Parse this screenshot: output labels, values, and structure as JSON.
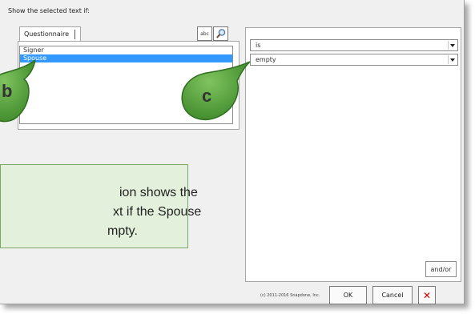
{
  "dialog": {
    "caption": "Show the selected text if:",
    "tab_label": "Questionnaire",
    "toolbar": {
      "abc_label": "abc",
      "search_icon": "search-icon"
    },
    "list_items": [
      "Signer",
      "Spouse"
    ],
    "selected_item": "Spouse",
    "condition": {
      "operator": "is",
      "value": "empty"
    },
    "andor_label": "and/or",
    "copyright": "(c) 2011-2016 Snapdone, Inc.",
    "buttons": {
      "ok": "OK",
      "cancel": "Cancel",
      "close": "✕"
    }
  },
  "callout": {
    "lines": [
      "ion shows the",
      "xt if the Spouse",
      "mpty."
    ]
  },
  "annotations": {
    "bubble_b": "b",
    "bubble_c": "c"
  },
  "colors": {
    "selection": "#3399ff",
    "callout_bg": "#e3f1dc",
    "bubble_fill": "#4f9a38",
    "close_red": "#cc0000"
  }
}
